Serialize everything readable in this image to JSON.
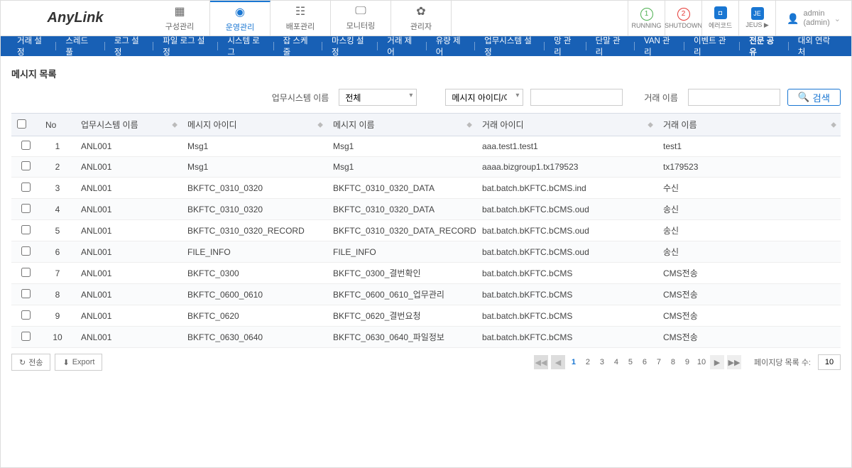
{
  "logo": "AnyLink",
  "main_tabs": [
    {
      "label": "구성관리",
      "icon": "▦"
    },
    {
      "label": "운영관리",
      "icon": "◉",
      "active": true
    },
    {
      "label": "배포관리",
      "icon": "☷"
    },
    {
      "label": "모니터링",
      "icon": "🖵"
    },
    {
      "label": "관리자",
      "icon": "✿"
    }
  ],
  "header_status": [
    {
      "num": "1",
      "label": "RUNNING",
      "style": "green"
    },
    {
      "num": "2",
      "label": "SHUTDOWN",
      "style": "red"
    },
    {
      "num": "◘",
      "label": "에러코드",
      "style": "blue-sq"
    },
    {
      "num": "JE",
      "label": "JEUS ▶",
      "style": "blue-sq"
    }
  ],
  "user": {
    "name": "admin",
    "sub": "(admin)"
  },
  "sub_nav": [
    "거래 설정",
    "스레드 풀",
    "로그 설정",
    "파일 로그 설정",
    "시스템 로그",
    "잡 스케줄",
    "마스킹 설정",
    "거래 제어",
    "유량 제어",
    "업무시스템 설정",
    "망 관리",
    "단말 관리",
    "VAN 관리",
    "이벤트 관리",
    "전문 공유",
    "대외 연락처"
  ],
  "sub_nav_active": "전문 공유",
  "page_title": "메시지 목록",
  "filters": {
    "biz_label": "업무시스템 이름",
    "biz_value": "전체",
    "msg_type": "메시지 아이디/이름",
    "tx_label": "거래 이름",
    "search_label": "검색"
  },
  "columns": {
    "no": "No",
    "biz": "업무시스템 이름",
    "msgid": "메시지 아이디",
    "msgname": "메시지 이름",
    "txid": "거래 아이디",
    "txname": "거래 이름"
  },
  "rows": [
    {
      "no": "1",
      "biz": "ANL001",
      "msgid": "Msg1",
      "msgname": "Msg1",
      "txid": "aaa.test1.test1",
      "txname": "test1"
    },
    {
      "no": "2",
      "biz": "ANL001",
      "msgid": "Msg1",
      "msgname": "Msg1",
      "txid": "aaaa.bizgroup1.tx179523",
      "txname": "tx179523"
    },
    {
      "no": "3",
      "biz": "ANL001",
      "msgid": "BKFTC_0310_0320",
      "msgname": "BKFTC_0310_0320_DATA",
      "txid": "bat.batch.bKFTC.bCMS.ind",
      "txname": "수신"
    },
    {
      "no": "4",
      "biz": "ANL001",
      "msgid": "BKFTC_0310_0320",
      "msgname": "BKFTC_0310_0320_DATA",
      "txid": "bat.batch.bKFTC.bCMS.oud",
      "txname": "송신"
    },
    {
      "no": "5",
      "biz": "ANL001",
      "msgid": "BKFTC_0310_0320_RECORD",
      "msgname": "BKFTC_0310_0320_DATA_RECORD",
      "txid": "bat.batch.bKFTC.bCMS.oud",
      "txname": "송신"
    },
    {
      "no": "6",
      "biz": "ANL001",
      "msgid": "FILE_INFO",
      "msgname": "FILE_INFO",
      "txid": "bat.batch.bKFTC.bCMS.oud",
      "txname": "송신"
    },
    {
      "no": "7",
      "biz": "ANL001",
      "msgid": "BKFTC_0300",
      "msgname": "BKFTC_0300_결번확인",
      "txid": "bat.batch.bKFTC.bCMS",
      "txname": "CMS전송"
    },
    {
      "no": "8",
      "biz": "ANL001",
      "msgid": "BKFTC_0600_0610",
      "msgname": "BKFTC_0600_0610_업무관리",
      "txid": "bat.batch.bKFTC.bCMS",
      "txname": "CMS전송"
    },
    {
      "no": "9",
      "biz": "ANL001",
      "msgid": "BKFTC_0620",
      "msgname": "BKFTC_0620_결번요청",
      "txid": "bat.batch.bKFTC.bCMS",
      "txname": "CMS전송"
    },
    {
      "no": "10",
      "biz": "ANL001",
      "msgid": "BKFTC_0630_0640",
      "msgname": "BKFTC_0630_0640_파일정보",
      "txid": "bat.batch.bKFTC.bCMS",
      "txname": "CMS전송"
    }
  ],
  "footer": {
    "send_label": "전송",
    "export_label": "Export",
    "pages": [
      "1",
      "2",
      "3",
      "4",
      "5",
      "6",
      "7",
      "8",
      "9",
      "10"
    ],
    "active_page": "1",
    "page_size_label": "페이지당 목록 수:",
    "page_size_value": "10"
  }
}
